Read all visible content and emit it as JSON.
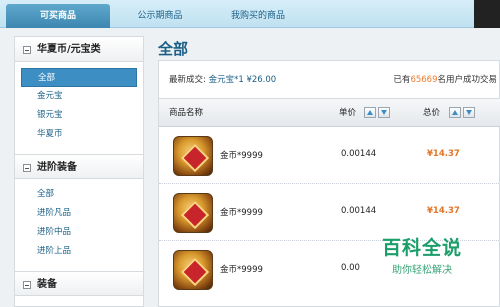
{
  "tabs": [
    "可买商品",
    "公示期商品",
    "我购买的商品"
  ],
  "sidebar": {
    "groups": [
      {
        "title": "华夏币/元宝类",
        "items": [
          "全部",
          "金元宝",
          "银元宝",
          "华夏币"
        ]
      },
      {
        "title": "进阶装备",
        "items": [
          "全部",
          "进阶凡品",
          "进阶中品",
          "进阶上品"
        ]
      },
      {
        "title": "装备",
        "items": []
      }
    ]
  },
  "main": {
    "title": "全部",
    "deal": {
      "prefix": "最新成交:",
      "item": "金元宝*1",
      "price": "¥26.00",
      "right_prefix": "已有",
      "user_count": "65669",
      "right_suffix": "名用户成功交易"
    },
    "table": {
      "headers": {
        "name": "商品名称",
        "unit_price": "单价",
        "total": "总价"
      },
      "rows": [
        {
          "name": "金币*9999",
          "unit_price": "0.00144",
          "total": "¥14.37"
        },
        {
          "name": "金币*9999",
          "unit_price": "0.00144",
          "total": "¥14.37"
        },
        {
          "name": "金币*9999",
          "unit_price": "0.00",
          "total": ""
        }
      ]
    }
  },
  "watermark": {
    "title": "百科全说",
    "subtitle": "助你轻松解决"
  }
}
